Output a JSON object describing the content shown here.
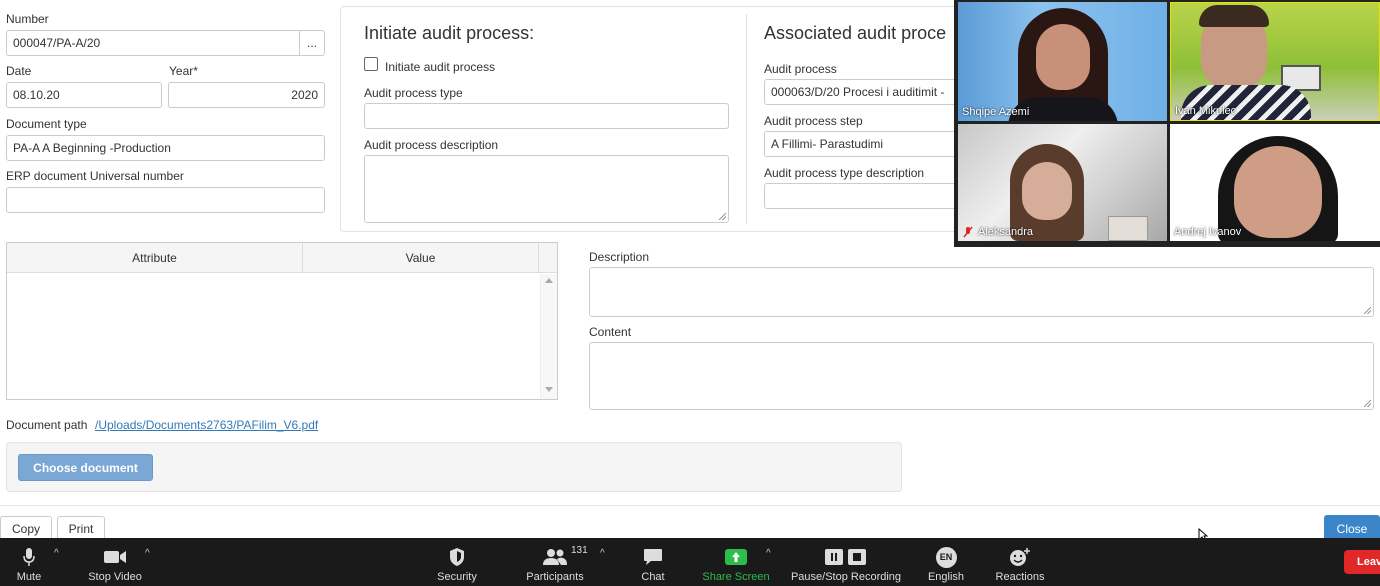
{
  "form": {
    "number_label": "Number",
    "number_value": "000047/PA-A/20",
    "number_button": "...",
    "date_label": "Date",
    "date_value": "08.10.20",
    "year_label": "Year*",
    "year_value": "2020",
    "doc_type_label": "Document type",
    "doc_type_value": "PA-A A Beginning -Production",
    "erp_label": "ERP document Universal number",
    "erp_value": ""
  },
  "initiate": {
    "heading": "Initiate audit process:",
    "checkbox_label": "Initiate audit process",
    "checked": false,
    "type_label": "Audit process type",
    "type_value": "",
    "desc_label": "Audit process description"
  },
  "associated": {
    "heading": "Associated audit proce",
    "process_label": "Audit process",
    "process_value": "000063/D/20 Procesi i auditimit -",
    "step_label": "Audit process step",
    "step_value": "A  Fillimi- Parastudimi",
    "type_desc_label": "Audit process type description",
    "type_desc_value": ""
  },
  "grid": {
    "columns": [
      "Attribute",
      "Value"
    ]
  },
  "right": {
    "description_label": "Description",
    "content_label": "Content"
  },
  "document": {
    "path_label": "Document path",
    "path_link": "/Uploads/Documents2763/PAFilim_V6.pdf",
    "choose_button": "Choose document"
  },
  "footer": {
    "copy": "Copy",
    "print": "Print",
    "close": "Close"
  },
  "video": {
    "participants": [
      "Shqipe Azemi",
      "Ivan Mikulec",
      "Aleksandra",
      "Andrej Ivanov"
    ]
  },
  "zoom": {
    "mute": "Mute",
    "stop_video": "Stop Video",
    "security": "Security",
    "participants": "Participants",
    "participants_count": "131",
    "chat": "Chat",
    "share_screen": "Share Screen",
    "recording": "Pause/Stop Recording",
    "language_badge": "EN",
    "english": "English",
    "reactions": "Reactions",
    "leave": "Leav"
  },
  "colors": {
    "accent": "#337ab7",
    "choose_button": "#7ba7d4",
    "close_button": "#3a86c8",
    "share_green": "#2dbd4a",
    "leave_red": "#e02828",
    "zoom_bar": "#1a1a1a"
  }
}
